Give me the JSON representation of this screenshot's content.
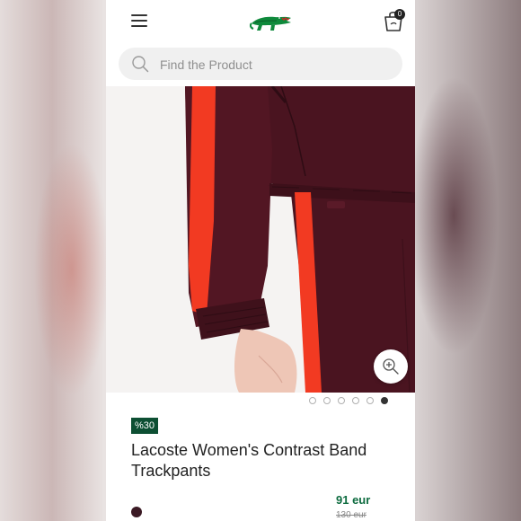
{
  "header": {
    "menu_icon": "hamburger-menu-icon",
    "logo_icon": "lacoste-crocodile-logo",
    "bag_icon": "shopping-bag-icon",
    "bag_count": "0"
  },
  "search": {
    "icon": "search-icon",
    "placeholder": "Find the Product"
  },
  "gallery": {
    "zoom_icon": "zoom-in-icon",
    "total_images": 6,
    "active_index": 5
  },
  "product": {
    "discount_badge": "%30",
    "title": "Lacoste Women's Contrast Band Trackpants",
    "color_swatch": "#3b1a24",
    "price": "91 eur",
    "old_price": "130 eur"
  },
  "colors": {
    "accent_green": "#0d4f33",
    "price_green": "#0d6b3f",
    "garment_burgundy": "#4a1420",
    "stripe_red": "#f23a22"
  }
}
